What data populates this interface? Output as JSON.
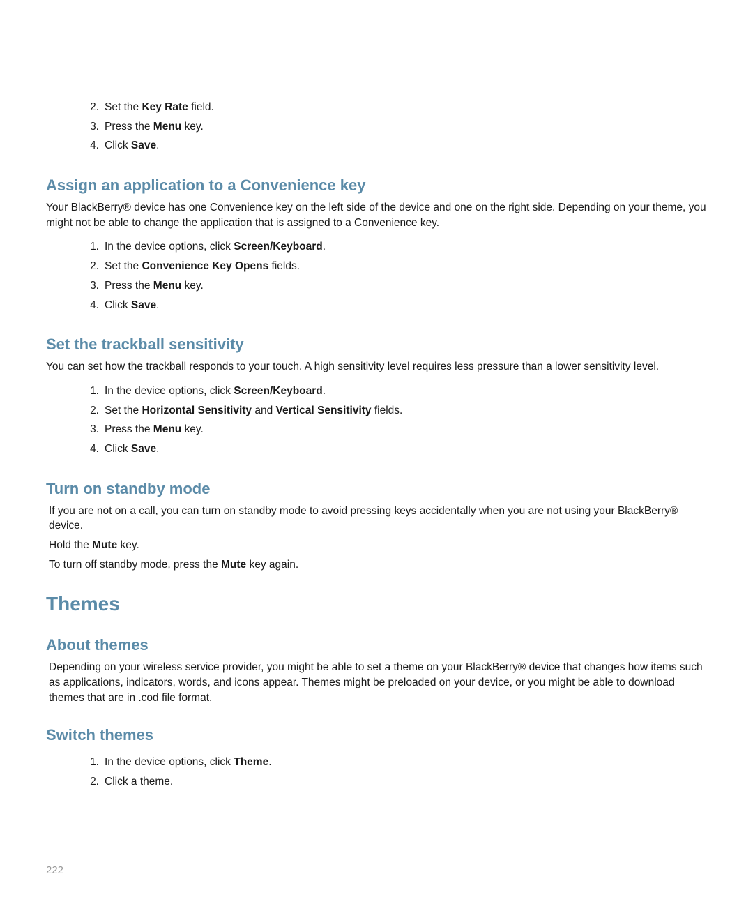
{
  "list1": {
    "n2": "2.",
    "t2_a": "Set the ",
    "t2_b": "Key Rate",
    "t2_c": " field.",
    "n3": "3.",
    "t3_a": "Press the ",
    "t3_b": "Menu",
    "t3_c": " key.",
    "n4": "4.",
    "t4_a": "Click ",
    "t4_b": "Save",
    "t4_c": "."
  },
  "sec1": {
    "title": "Assign an application to a Convenience key",
    "para": "Your BlackBerry® device has one Convenience key on the left side of the device and one on the right side. Depending on your theme, you might not be able to change the application that is assigned to a Convenience key.",
    "n1": "1.",
    "t1_a": "In the device options, click ",
    "t1_b": "Screen/Keyboard",
    "t1_c": ".",
    "n2": "2.",
    "t2_a": "Set the ",
    "t2_b": "Convenience Key Opens",
    "t2_c": " fields.",
    "n3": "3.",
    "t3_a": "Press the ",
    "t3_b": "Menu",
    "t3_c": " key.",
    "n4": "4.",
    "t4_a": "Click ",
    "t4_b": "Save",
    "t4_c": "."
  },
  "sec2": {
    "title": "Set the trackball sensitivity",
    "para": "You can set how the trackball responds to your touch. A high sensitivity level requires less pressure than a lower sensitivity level.",
    "n1": "1.",
    "t1_a": "In the device options, click ",
    "t1_b": "Screen/Keyboard",
    "t1_c": ".",
    "n2": "2.",
    "t2_a": "Set the ",
    "t2_b": "Horizontal Sensitivity",
    "t2_mid": " and ",
    "t2_b2": "Vertical Sensitivity",
    "t2_c": " fields.",
    "n3": "3.",
    "t3_a": "Press the ",
    "t3_b": "Menu",
    "t3_c": " key.",
    "n4": "4.",
    "t4_a": "Click ",
    "t4_b": "Save",
    "t4_c": "."
  },
  "sec3": {
    "title": "Turn on standby mode",
    "para1": "If you are not on a call, you can turn on standby mode to avoid pressing keys accidentally when you are not using your BlackBerry® device.",
    "para2_a": "Hold the ",
    "para2_b": "Mute",
    "para2_c": " key.",
    "para3_a": "To turn off standby mode, press the ",
    "para3_b": "Mute",
    "para3_c": " key again."
  },
  "sec4": {
    "title": "Themes"
  },
  "sec5": {
    "title": "About themes",
    "para": "Depending on your wireless service provider, you might be able to set a theme on your BlackBerry® device that changes how items such as applications, indicators, words, and icons appear. Themes might be preloaded on your device, or you might be able to download themes that are in .cod file format."
  },
  "sec6": {
    "title": "Switch themes",
    "n1": "1.",
    "t1_a": "In the device options, click ",
    "t1_b": "Theme",
    "t1_c": ".",
    "n2": "2.",
    "t2": "Click a theme."
  },
  "page_number": "222"
}
